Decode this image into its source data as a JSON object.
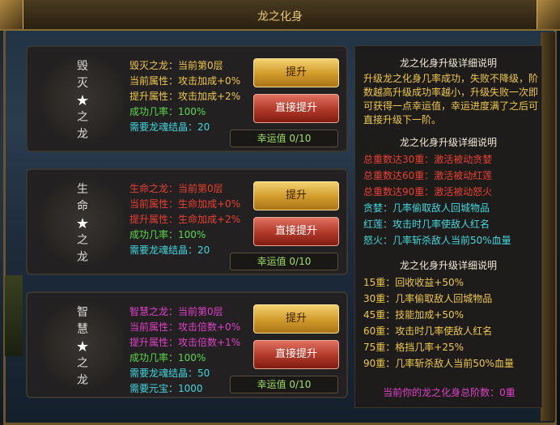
{
  "window": {
    "title": "龙之化身"
  },
  "dragons": [
    {
      "emblem": [
        "毁",
        "灭",
        "★",
        "之",
        "龙"
      ],
      "name_line": "毁灭之龙：当前第0层",
      "current_attr": "当前属性：攻击加成+0%",
      "next_attr": "提升属性：攻击加成+2%",
      "success_rate": "成功几率：100%",
      "cost1": "需要龙魂结晶：20",
      "cost2": "",
      "upgrade_label": "提升",
      "direct_label": "直接提升",
      "luck_text": "幸运值 0/10",
      "luck_fraction": 0,
      "name_color": "#f0c848",
      "attr_color": "#f0c848"
    },
    {
      "emblem": [
        "生",
        "命",
        "★",
        "之",
        "龙"
      ],
      "name_line": "生命之龙：当前第0层",
      "current_attr": "当前属性：生命加成+0%",
      "next_attr": "提升属性：生命加成+2%",
      "success_rate": "成功几率：100%",
      "cost1": "需要龙魂结晶：20",
      "cost2": "",
      "upgrade_label": "提升",
      "direct_label": "直接提升",
      "luck_text": "幸运值 0/10",
      "luck_fraction": 0,
      "name_color": "#e84030",
      "attr_color": "#e84030"
    },
    {
      "emblem": [
        "智",
        "慧",
        "★",
        "之",
        "龙"
      ],
      "name_line": "智慧之龙：当前第0层",
      "current_attr": "当前属性：攻击倍数+0%",
      "next_attr": "提升属性：攻击倍数+1%",
      "success_rate": "成功几率：100%",
      "cost1": "需要龙魂结晶：50",
      "cost2": "需要元宝：1000",
      "upgrade_label": "提升",
      "direct_label": "直接提升",
      "luck_text": "幸运值 0/10",
      "luck_fraction": 0,
      "name_color": "#e040c8",
      "attr_color": "#e040c8"
    }
  ],
  "side": {
    "heading1": "龙之化身升级详细说明",
    "desc": "升级龙之化身几率成功，失败不降级，阶数越高升级成功率越小，升级失败一次即可获得一点幸运值，幸运进度满了之后可直接升级下一阶。",
    "heading2": "龙之化身升级详细说明",
    "list2": [
      {
        "text": "总重数达30重：激活被动贪婪",
        "cls": "red"
      },
      {
        "text": "总重数达60重：激活被动红莲",
        "cls": "red"
      },
      {
        "text": "总重数达90重：激活被动怒火",
        "cls": "red"
      },
      {
        "text": "贪婪：几率偷取敌人回城物品",
        "cls": "cyan"
      },
      {
        "text": "红莲：攻击时几率使敌人红名",
        "cls": "cyan"
      },
      {
        "text": "怒火：几率斩杀敌人当前50%血量",
        "cls": "cyan"
      }
    ],
    "heading3": "龙之化身升级详细说明",
    "list3": [
      "15重：回收收益+50%",
      "30重：几率偷取敌人回城物品",
      "45重：技能加成+50%",
      "60重：攻击时几率使敌人红名",
      "75重：格挡几率+25%",
      "90重：几率斩杀敌人当前50%血量"
    ],
    "total": "当前你的龙之化身总阶数：0重"
  },
  "colors": {
    "green": "#5ad848",
    "cyan": "#40d8e0"
  }
}
